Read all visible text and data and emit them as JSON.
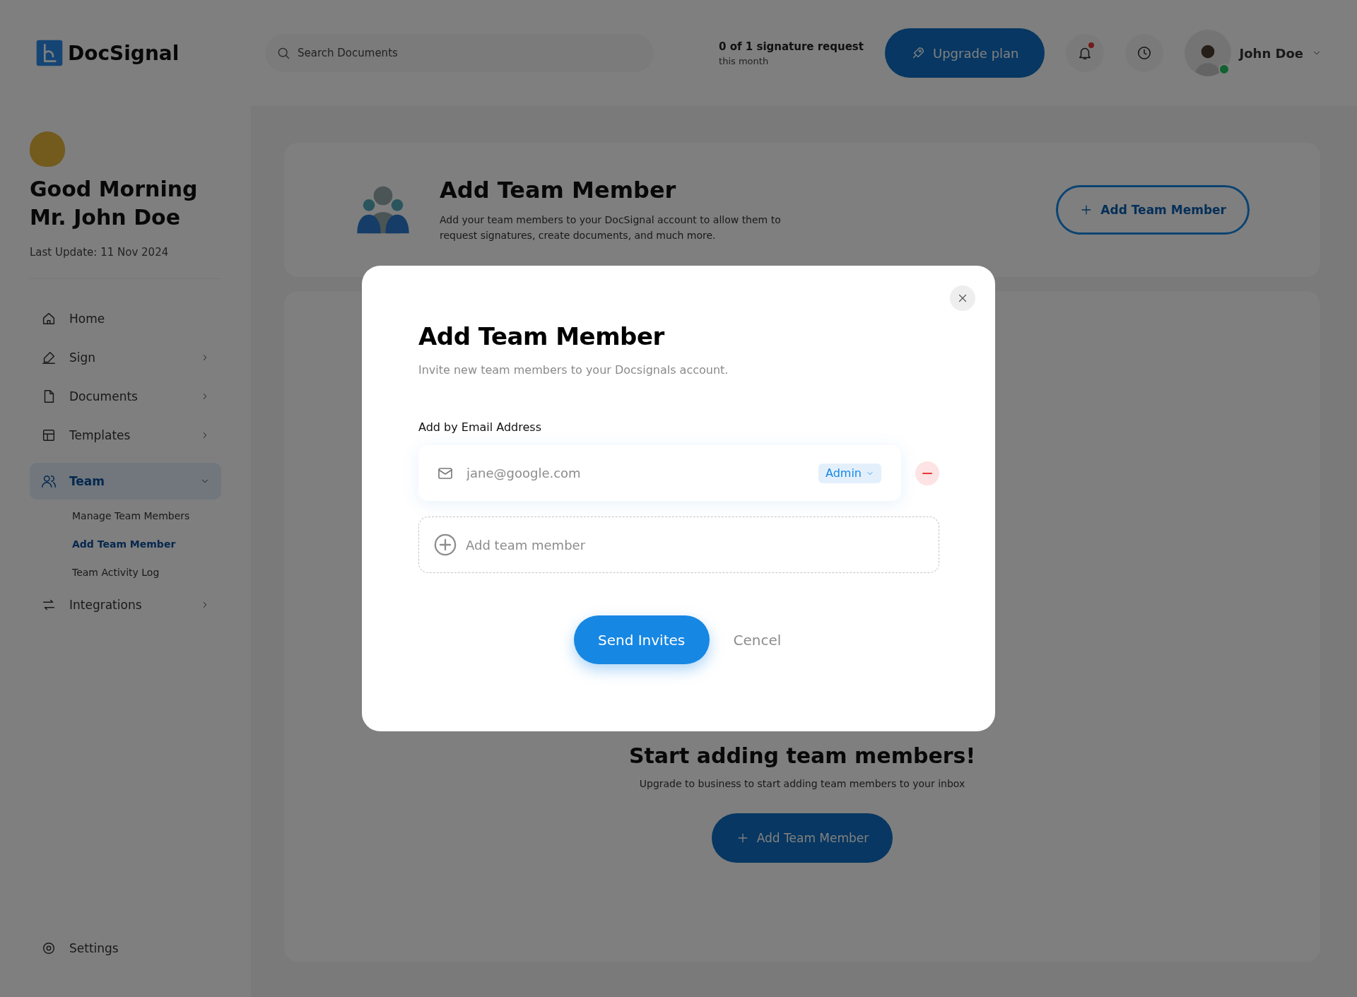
{
  "header": {
    "logo": "DocSignal",
    "search": {
      "placeholder": "Search Documents"
    },
    "quota": {
      "title": "0 of 1 signature request",
      "subtitle": "this month"
    },
    "upgrade_button": "Upgrade plan",
    "notifications": {
      "unread": true
    },
    "user": {
      "name": "John Doe",
      "online": true
    }
  },
  "sidebar": {
    "greeting": [
      "Good Morning",
      "Mr. John Doe"
    ],
    "last_update": "Last Update: 11 Nov 2024",
    "items": [
      {
        "label": "Home",
        "kind": "link",
        "selected": false
      },
      {
        "label": "Sign",
        "kind": "menu",
        "selected": false,
        "expanded": false
      },
      {
        "label": "Documents",
        "kind": "menu",
        "selected": false,
        "expanded": false
      },
      {
        "label": "Templates",
        "kind": "menu",
        "selected": false,
        "expanded": false
      },
      {
        "label": "Team",
        "kind": "menu",
        "selected": true,
        "expanded": true,
        "children": [
          {
            "label": "Manage Team Members",
            "selected": false
          },
          {
            "label": "Add Team Member",
            "selected": true
          },
          {
            "label": "Team Activity Log",
            "selected": false
          }
        ]
      },
      {
        "label": "Integrations",
        "kind": "menu",
        "selected": false,
        "expanded": false
      }
    ],
    "settings": "Settings"
  },
  "main": {
    "banner": {
      "title": "Add Team Member",
      "description": "Add your team members to your DocSignal account to allow them to request signatures, create documents, and much more.",
      "button": "Add Team Member"
    },
    "empty_state": {
      "title": "Start adding team members!",
      "description": "Upgrade to business to start adding team members to your inbox",
      "button": "Add Team Member"
    }
  },
  "modal": {
    "title": "Add Team Member",
    "subtitle": "Invite new team members to your Docsignals account.",
    "section_label": "Add by Email Address",
    "members": [
      {
        "placeholder": "jane@google.com",
        "role": "Admin"
      }
    ],
    "add_row": "Add team member",
    "primary_button": "Send Invites",
    "secondary_button": "Cencel"
  }
}
